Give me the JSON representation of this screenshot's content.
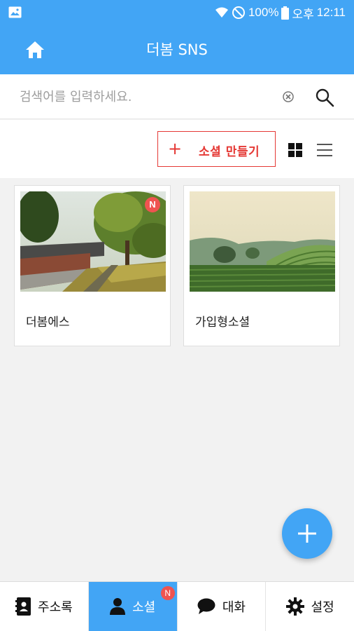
{
  "status_bar": {
    "battery": "100%",
    "ampm": "오후",
    "time": "12:11",
    "icons": [
      "image-icon",
      "wifi-icon",
      "no-disturb-icon",
      "battery-icon"
    ]
  },
  "app_bar": {
    "title": "더봄 SNS",
    "home_icon": "home-icon"
  },
  "search": {
    "placeholder": "검색어를 입력하세요.",
    "value": "",
    "clear_icon": "clear-icon",
    "search_icon": "search-icon"
  },
  "toolbar": {
    "create_plus": "+",
    "create_label": "소셜 만들기",
    "view_modes": [
      "grid-view-icon",
      "list-view-icon"
    ]
  },
  "cards": [
    {
      "name": "더봄에스",
      "is_new": true,
      "badge": "N",
      "photo": "traditional-wall-trees"
    },
    {
      "name": "가입형소셜",
      "is_new": false,
      "badge": "",
      "photo": "green-tea-field"
    }
  ],
  "fab": {
    "icon": "plus-icon"
  },
  "bottom_nav": [
    {
      "label": "주소록",
      "icon": "contacts-icon",
      "active": false
    },
    {
      "label": "소셜",
      "icon": "person-icon",
      "active": true,
      "badge": "N"
    },
    {
      "label": "대화",
      "icon": "chat-icon",
      "active": false
    },
    {
      "label": "설정",
      "icon": "gear-icon",
      "active": false
    }
  ],
  "colors": {
    "primary": "#42a5f5",
    "accent_red": "#e53935",
    "badge": "#ef5350",
    "background": "#f2f2f2"
  }
}
